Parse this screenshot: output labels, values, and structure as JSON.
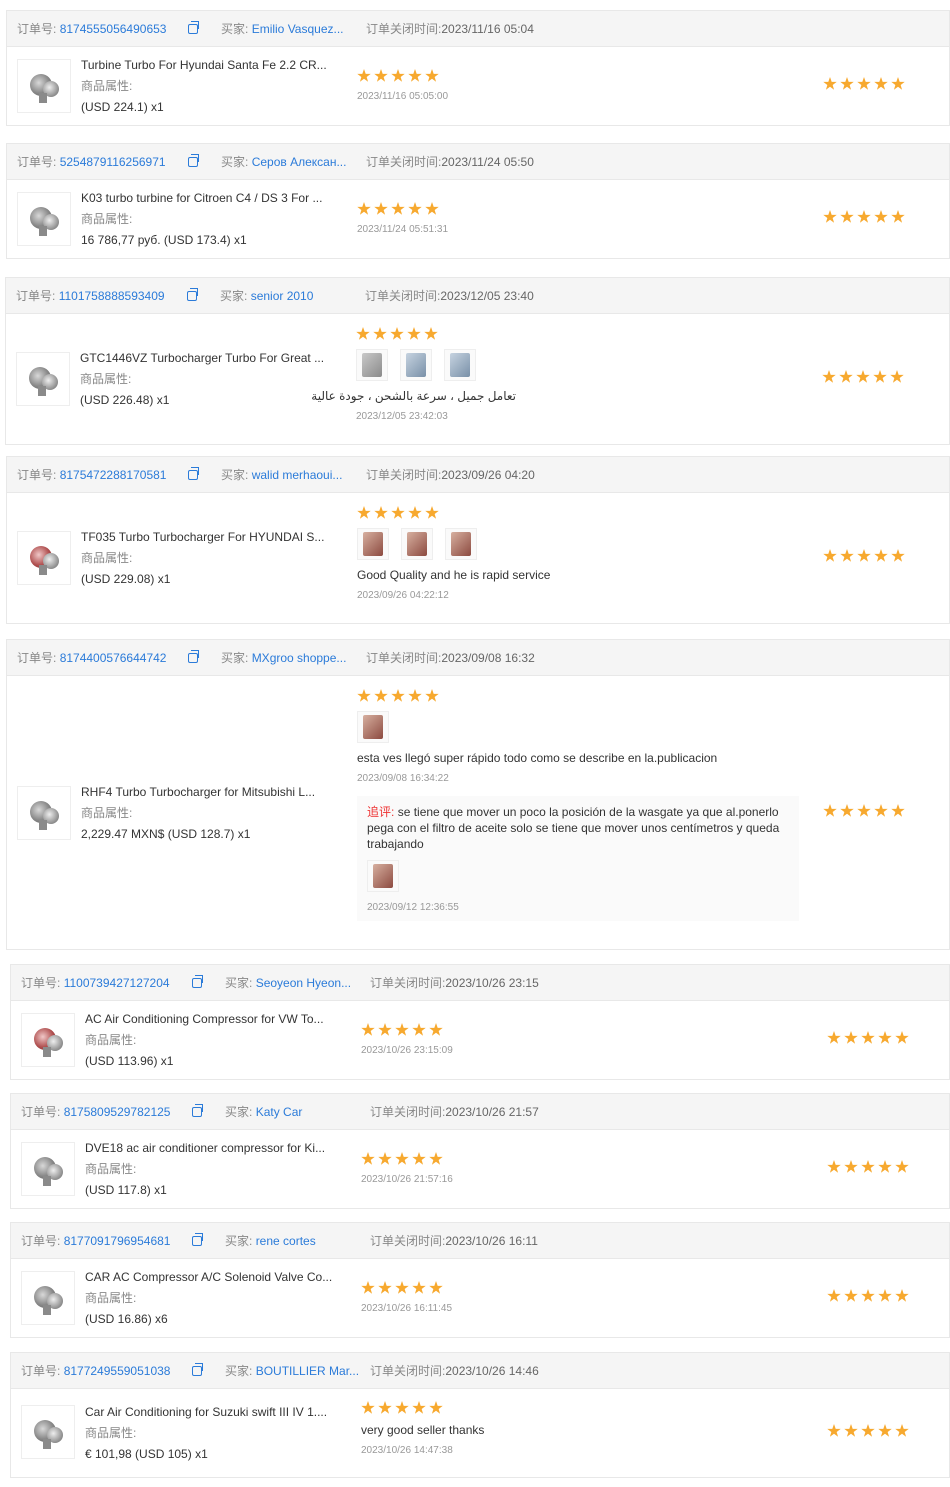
{
  "labels": {
    "order_no": "订单号:",
    "buyer": "买家:",
    "closed": "订单关闭时间:",
    "attr": "商品属性:",
    "followup": "追评:"
  },
  "orders": [
    {
      "order_no": "8174555056490653",
      "buyer": "Emilio Vasquez...",
      "closed_time": "2023/11/16 05:04",
      "title": "Turbine Turbo For Hyundai Santa Fe 2.2 CR...",
      "price": "(USD  224.1)  x1",
      "review_date": "2023/11/16 05:05:00",
      "review_text": "",
      "rating": 5,
      "seller_rating": 5
    },
    {
      "order_no": "5254879116256971",
      "buyer": "Серов Алексан...",
      "closed_time": "2023/11/24 05:50",
      "title": "K03 turbo turbine for Citroen C4 / DS 3 For ...",
      "price": "16 786,77 руб.  (USD  173.4)  x1",
      "review_date": "2023/11/24 05:51:31",
      "review_text": "",
      "rating": 5,
      "seller_rating": 5
    },
    {
      "order_no": "1101758888593409",
      "buyer": "senior 2010",
      "closed_time": "2023/12/05 23:40",
      "title": "GTC1446VZ Turbocharger Turbo For Great ...",
      "price": "(USD  226.48)  x1",
      "review_date": "2023/12/05 23:42:03",
      "review_text": "تعامل جميل ، سرعة بالشحن ، جودة عالية",
      "rating": 5,
      "seller_rating": 5
    },
    {
      "order_no": "8175472288170581",
      "buyer": "walid merhaoui...",
      "closed_time": "2023/09/26 04:20",
      "title": "TF035 Turbo Turbocharger For HYUNDAI S...",
      "price": "(USD  229.08)  x1",
      "review_date": "2023/09/26 04:22:12",
      "review_text": "Good Quality and he is rapid service",
      "rating": 5,
      "seller_rating": 5
    },
    {
      "order_no": "8174400576644742",
      "buyer": "MXgroo shoppe...",
      "closed_time": "2023/09/08 16:32",
      "title": "RHF4 Turbo Turbocharger for Mitsubishi L...",
      "price": "2,229.47 MXN$  (USD  128.7)  x1",
      "review_date": "2023/09/08 16:34:22",
      "review_text": "esta ves llegó super rápido todo como se describe en la.publicacion",
      "followup_text": "se tiene que mover un poco la posición de la wasgate ya que al.ponerlo pega con el filtro de aceite solo se tiene que mover unos centímetros y queda trabajando",
      "followup_date": "2023/09/12 12:36:55",
      "rating": 5,
      "seller_rating": 5
    },
    {
      "order_no": "1100739427127204",
      "buyer": "Seoyeon Hyeon...",
      "closed_time": "2023/10/26 23:15",
      "title": "AC Air Conditioning Compressor for VW To...",
      "price": "(USD  113.96)  x1",
      "review_date": "2023/10/26 23:15:09",
      "review_text": "",
      "rating": 5,
      "seller_rating": 5
    },
    {
      "order_no": "8175809529782125",
      "buyer": "Katy Car",
      "closed_time": "2023/10/26 21:57",
      "title": "DVE18 ac air conditioner compressor for Ki...",
      "price": "(USD  117.8)  x1",
      "review_date": "2023/10/26 21:57:16",
      "review_text": "",
      "rating": 5,
      "seller_rating": 5
    },
    {
      "order_no": "8177091796954681",
      "buyer": "rene cortes",
      "closed_time": "2023/10/26 16:11",
      "title": "CAR AC Compressor A/C Solenoid Valve Co...",
      "price": "(USD  16.86)  x6",
      "review_date": "2023/10/26 16:11:45",
      "review_text": "",
      "rating": 5,
      "seller_rating": 5
    },
    {
      "order_no": "8177249559051038",
      "buyer": "BOUTILLIER Mar...",
      "closed_time": "2023/10/26 14:46",
      "title": "Car Air Conditioning for Suzuki swift III IV 1....",
      "price": "€ 101,98  (USD  105)  x1",
      "review_date": "2023/10/26 14:47:38",
      "review_text": "very good seller thanks",
      "rating": 5,
      "seller_rating": 5
    }
  ]
}
